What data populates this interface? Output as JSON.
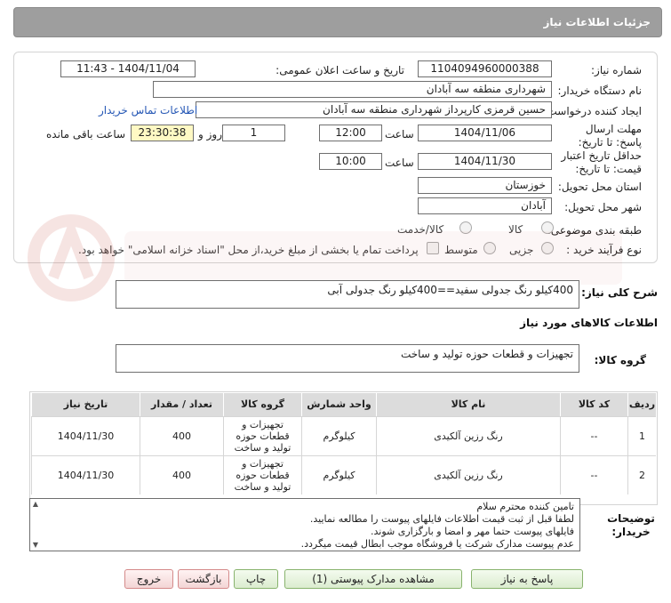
{
  "header": {
    "title": "جزئیات اطلاعات نیاز"
  },
  "form": {
    "need_number_label": "شماره نیاز:",
    "need_number": "1104094960000388",
    "announce_label": "تاریخ و ساعت اعلان عمومی:",
    "announce_value": "1404/11/04 - 11:43",
    "buyer_org_label": "نام دستگاه خریدار:",
    "buyer_org": "شهرداری منطقه سه آبادان",
    "creator_label": "ایجاد کننده درخواست:",
    "creator": "حسین قرمزی کارپرداز شهرداری منطقه سه آبادان",
    "contact_link": "اطلاعات تماس خریدار",
    "deadline_label": "مهلت ارسال پاسخ: تا تاریخ:",
    "deadline_date": "1404/11/06",
    "time_label": "ساعت",
    "deadline_time": "12:00",
    "days_count": "1",
    "days_label": "روز و",
    "remaining_time": "23:30:38",
    "remaining_label": "ساعت باقی مانده",
    "validity_label": "حداقل تاریخ اعتبار قیمت: تا تاریخ:",
    "validity_date": "1404/11/30",
    "validity_time": "10:00",
    "province_label": "استان محل تحویل:",
    "province": "خوزستان",
    "city_label": "شهر محل تحویل:",
    "city": "آبادان",
    "category_label": "طبقه بندی موضوعی:",
    "category_options": [
      "کالا",
      "کالا/خدمت"
    ],
    "process_label": "نوع فرآیند خرید :",
    "process_options": [
      "جزیی",
      "متوسط"
    ],
    "payment_note": "پرداخت تمام یا بخشی از مبلغ خرید،از محل \"اسناد خزانه اسلامی\" خواهد بود."
  },
  "description": {
    "label": "شرح کلی نیاز:",
    "value": "400کیلو رنگ جدولی سفید==400کیلو رنگ جدولی آبی"
  },
  "goods_info": {
    "title": "اطلاعات کالاهای مورد نیاز",
    "group_label": "گروه کالا:",
    "group_value": "تجهیزات و قطعات حوزه تولید و ساخت"
  },
  "table": {
    "headers": [
      "ردیف",
      "کد کالا",
      "نام کالا",
      "واحد شمارش",
      "گروه کالا",
      "تعداد / مقدار",
      "تاریخ نیاز"
    ],
    "rows": [
      [
        "1",
        "--",
        "رنگ رزین آلکیدی",
        "کیلوگرم",
        "تجهیزات و قطعات حوزه تولید و ساخت",
        "400",
        "1404/11/30"
      ],
      [
        "2",
        "--",
        "رنگ رزین آلکیدی",
        "کیلوگرم",
        "تجهیزات و قطعات حوزه تولید و ساخت",
        "400",
        "1404/11/30"
      ]
    ]
  },
  "notes": {
    "label": "توضیحات خریدار:",
    "lines": [
      "تامین کننده محترم سلام",
      "لطفا قبل از ثبت قیمت اطلاعات فایلهای پیوست را مطالعه نمایید.",
      "فایلهای پیوست حتما مهر و امضا و بارگزاری شوند.",
      "عدم پیوست مدارک شرکت یا فروشگاه موجب ابطال قیمت میگردد."
    ]
  },
  "buttons": {
    "reply": "پاسخ به نیاز",
    "attachments": "مشاهده مدارک پیوستی (1)",
    "print": "چاپ",
    "back": "بازگشت",
    "exit": "خروج"
  }
}
